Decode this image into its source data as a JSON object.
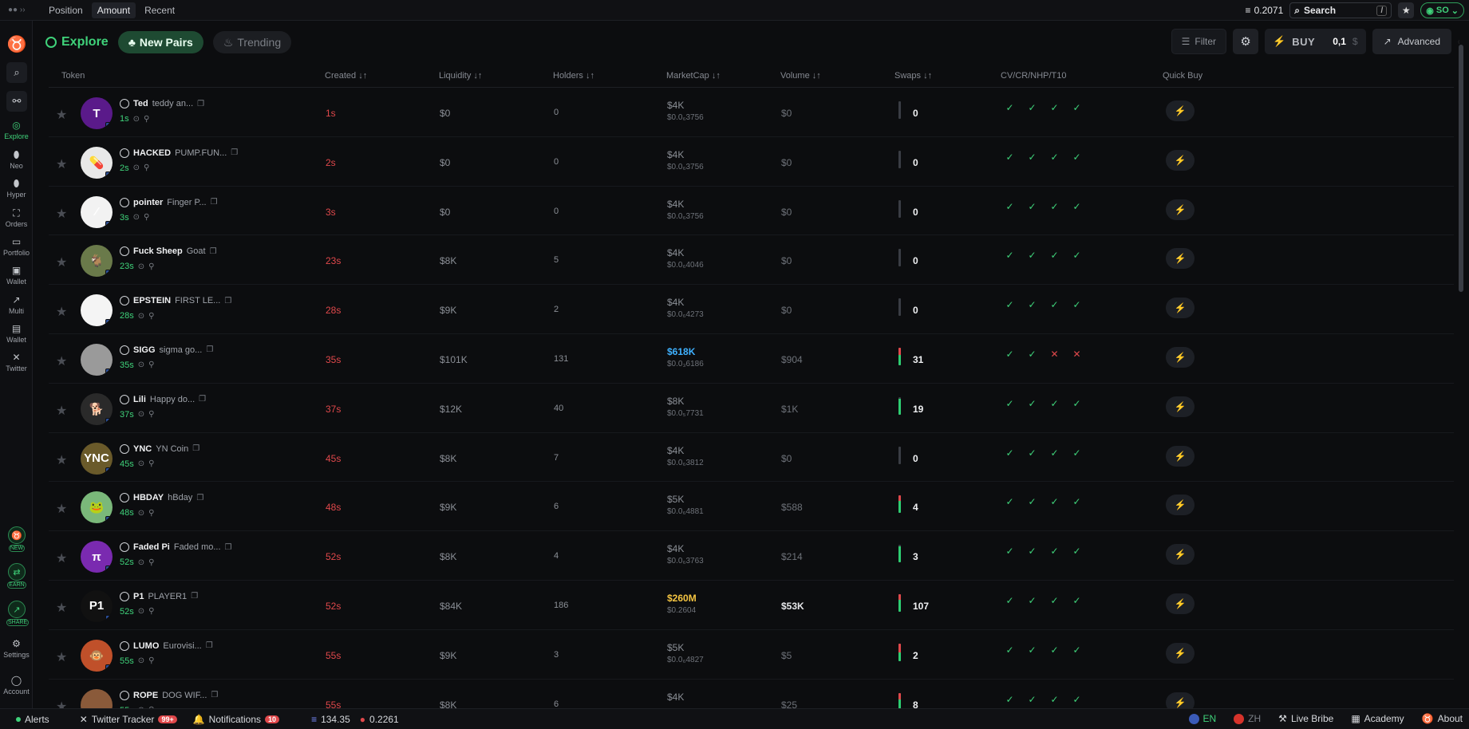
{
  "topbar": {
    "tabs": [
      "Position",
      "Amount",
      "Recent"
    ],
    "balance": "0.2071",
    "search_label": "Search",
    "search_shortcut": "/",
    "account": "SO"
  },
  "sidebar": {
    "items": [
      {
        "label": "Explore",
        "icon": "explore-icon"
      },
      {
        "label": "Neo",
        "icon": "pill-icon"
      },
      {
        "label": "Hyper",
        "icon": "pill-icon"
      },
      {
        "label": "Orders",
        "icon": "orders-icon"
      },
      {
        "label": "Portfolio",
        "icon": "briefcase-icon"
      },
      {
        "label": "Wallet",
        "icon": "wallet-icon"
      },
      {
        "label": "Multi",
        "icon": "chart-icon"
      },
      {
        "label": "Wallet",
        "icon": "wallet-doc-icon"
      },
      {
        "label": "Twitter",
        "icon": "x-icon"
      }
    ],
    "badges": [
      "NEW",
      "EARN",
      "SHARE"
    ],
    "bottom": [
      {
        "label": "Settings",
        "icon": "gear-icon"
      },
      {
        "label": "Account",
        "icon": "account-icon"
      }
    ]
  },
  "header": {
    "title": "Explore",
    "tab_new": "New Pairs",
    "tab_trending": "Trending",
    "filter": "Filter",
    "buy_label": "BUY",
    "buy_amount": "0,1",
    "buy_currency": "$",
    "advanced": "Advanced"
  },
  "columns": {
    "token": "Token",
    "created": "Created ↓↑",
    "liquidity": "Liquidity ↓↑",
    "holders": "Holders ↓↑",
    "marketcap": "MarketCap ↓↑",
    "volume": "Volume ↓↑",
    "swaps": "Swaps ↓↑",
    "checks": "CV/CR/NHP/T10",
    "quickbuy": "Quick Buy"
  },
  "rows": [
    {
      "sym": "Ted",
      "name": "teddy an...",
      "age": "1s",
      "created": "1s",
      "liq": "$0",
      "holders": "0",
      "mc": "$4K",
      "price": "$0.0₆3756",
      "vol": "$0",
      "swaps": "0",
      "checks": [
        "✓",
        "✓",
        "✓",
        "✓"
      ],
      "avatar_text": "T",
      "avatar_color": "#5a1a8a",
      "mc_class": "",
      "vol_class": "",
      "green": 0,
      "red": 0
    },
    {
      "sym": "HACKED",
      "name": "PUMP.FUN...",
      "age": "2s",
      "created": "2s",
      "liq": "$0",
      "holders": "0",
      "mc": "$4K",
      "price": "$0.0₆3756",
      "vol": "$0",
      "swaps": "0",
      "checks": [
        "✓",
        "✓",
        "✓",
        "✓"
      ],
      "avatar_text": "💊",
      "avatar_color": "#e8e8e8",
      "mc_class": "",
      "vol_class": "",
      "green": 0,
      "red": 0
    },
    {
      "sym": "pointer",
      "name": "Finger P...",
      "age": "3s",
      "created": "3s",
      "liq": "$0",
      "holders": "0",
      "mc": "$4K",
      "price": "$0.0₆3756",
      "vol": "$0",
      "swaps": "0",
      "checks": [
        "✓",
        "✓",
        "✓",
        "✓"
      ],
      "avatar_text": "⁄",
      "avatar_color": "#f2f2f2",
      "mc_class": "",
      "vol_class": "",
      "green": 0,
      "red": 0
    },
    {
      "sym": "Fuck Sheep",
      "name": "Goat",
      "age": "23s",
      "created": "23s",
      "liq": "$8K",
      "holders": "5",
      "mc": "$4K",
      "price": "$0.0₆4046",
      "vol": "$0",
      "swaps": "0",
      "checks": [
        "✓",
        "✓",
        "✓",
        "✓"
      ],
      "avatar_text": "🐐",
      "avatar_color": "#6a7a4a",
      "mc_class": "",
      "vol_class": "",
      "green": 0,
      "red": 0
    },
    {
      "sym": "EPSTEIN",
      "name": "FIRST LE...",
      "age": "28s",
      "created": "28s",
      "liq": "$9K",
      "holders": "2",
      "mc": "$4K",
      "price": "$0.0₆4273",
      "vol": "$0",
      "swaps": "0",
      "checks": [
        "✓",
        "✓",
        "✓",
        "✓"
      ],
      "avatar_text": "",
      "avatar_color": "#f4f4f4",
      "mc_class": "",
      "vol_class": "",
      "green": 0,
      "red": 0
    },
    {
      "sym": "SIGG",
      "name": "sigma go...",
      "age": "35s",
      "created": "35s",
      "liq": "$101K",
      "holders": "131",
      "mc": "$618K",
      "price": "$0.0₃6186",
      "vol": "$904",
      "swaps": "31",
      "checks": [
        "✓",
        "✓",
        "✕",
        "✕"
      ],
      "avatar_text": "",
      "avatar_color": "#9a9a9a",
      "mc_class": "hl-blue",
      "vol_class": "",
      "green": 0.6,
      "red": 0.4
    },
    {
      "sym": "Lili",
      "name": "Happy do...",
      "age": "37s",
      "created": "37s",
      "liq": "$12K",
      "holders": "40",
      "mc": "$8K",
      "price": "$0.0₅7731",
      "vol": "$1K",
      "swaps": "19",
      "checks": [
        "✓",
        "✓",
        "✓",
        "✓"
      ],
      "avatar_text": "🐕",
      "avatar_color": "#2a2a2a",
      "mc_class": "",
      "vol_class": "",
      "green": 0.9,
      "red": 0
    },
    {
      "sym": "YNC",
      "name": "YN Coin",
      "age": "45s",
      "created": "45s",
      "liq": "$8K",
      "holders": "7",
      "mc": "$4K",
      "price": "$0.0₆3812",
      "vol": "$0",
      "swaps": "0",
      "checks": [
        "✓",
        "✓",
        "✓",
        "✓"
      ],
      "avatar_text": "YNC",
      "avatar_color": "#6a5a2a",
      "mc_class": "",
      "vol_class": "",
      "green": 0,
      "red": 0
    },
    {
      "sym": "HBDAY",
      "name": "hBday",
      "age": "48s",
      "created": "48s",
      "liq": "$9K",
      "holders": "6",
      "mc": "$5K",
      "price": "$0.0₆4881",
      "vol": "$588",
      "swaps": "4",
      "checks": [
        "✓",
        "✓",
        "✓",
        "✓"
      ],
      "avatar_text": "🐸",
      "avatar_color": "#7ab87a",
      "mc_class": "",
      "vol_class": "",
      "green": 0.7,
      "red": 0.3
    },
    {
      "sym": "Faded Pi",
      "name": "Faded mo...",
      "age": "52s",
      "created": "52s",
      "liq": "$8K",
      "holders": "4",
      "mc": "$4K",
      "price": "$0.0₆3763",
      "vol": "$214",
      "swaps": "3",
      "checks": [
        "✓",
        "✓",
        "✓",
        "✓"
      ],
      "avatar_text": "π",
      "avatar_color": "#7a2ab0",
      "mc_class": "",
      "vol_class": "",
      "green": 0.9,
      "red": 0
    },
    {
      "sym": "P1",
      "name": "PLAYER1",
      "age": "52s",
      "created": "52s",
      "liq": "$84K",
      "holders": "186",
      "mc": "$260M",
      "price": "$0.2604",
      "vol": "$53K",
      "swaps": "107",
      "checks": [
        "✓",
        "✓",
        "✓",
        "✓"
      ],
      "avatar_text": "P1",
      "avatar_color": "#111111",
      "mc_class": "hl-yellow",
      "vol_class": "bright",
      "green": 0.7,
      "red": 0.3
    },
    {
      "sym": "LUMO",
      "name": "Eurovisi...",
      "age": "55s",
      "created": "55s",
      "liq": "$9K",
      "holders": "3",
      "mc": "$5K",
      "price": "$0.0₆4827",
      "vol": "$5",
      "swaps": "2",
      "checks": [
        "✓",
        "✓",
        "✓",
        "✓"
      ],
      "avatar_text": "🐵",
      "avatar_color": "#c0502a",
      "mc_class": "",
      "vol_class": "",
      "green": 0.5,
      "red": 0.5
    },
    {
      "sym": "ROPE",
      "name": "DOG WIF...",
      "age": "55s",
      "created": "55s",
      "liq": "$8K",
      "holders": "6",
      "mc": "$4K",
      "price": "",
      "vol": "$25",
      "swaps": "8",
      "checks": [
        "✓",
        "✓",
        "✓",
        "✓"
      ],
      "avatar_text": "",
      "avatar_color": "#8a5a3a",
      "mc_class": "",
      "vol_class": "",
      "green": 0.6,
      "red": 0.4
    }
  ],
  "footer": {
    "alerts": "Alerts",
    "twitter": "Twitter Tracker",
    "twitter_badge": "99+",
    "notifications": "Notifications",
    "notif_badge": "10",
    "sol_price": "134.35",
    "other_price": "0.2261",
    "lang_en": "EN",
    "lang_zh": "ZH",
    "live_bribe": "Live Bribe",
    "academy": "Academy",
    "about": "About"
  }
}
